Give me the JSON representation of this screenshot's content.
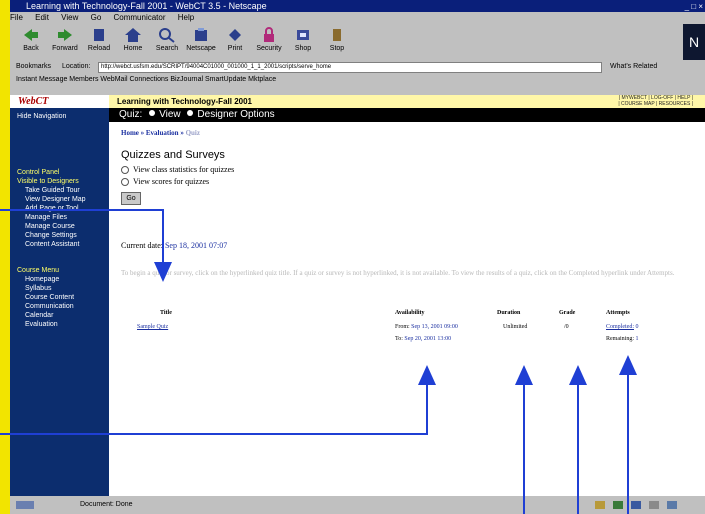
{
  "window": {
    "title": "Learning with Technology-Fall 2001 - WebCT 3.5 - Netscape",
    "controls": "_ □ ×"
  },
  "menu": [
    "File",
    "Edit",
    "View",
    "Go",
    "Communicator",
    "Help"
  ],
  "toolbar": {
    "buttons": [
      {
        "label": "Back",
        "icon": "back-arrow-icon"
      },
      {
        "label": "Forward",
        "icon": "forward-arrow-icon"
      },
      {
        "label": "Reload",
        "icon": "reload-icon"
      },
      {
        "label": "Home",
        "icon": "home-icon"
      },
      {
        "label": "Search",
        "icon": "search-icon"
      },
      {
        "label": "Netscape",
        "icon": "netscape-icon"
      },
      {
        "label": "Print",
        "icon": "print-icon"
      },
      {
        "label": "Security",
        "icon": "lock-icon"
      },
      {
        "label": "Shop",
        "icon": "shop-icon"
      },
      {
        "label": "Stop",
        "icon": "stop-icon"
      }
    ],
    "logo": "N"
  },
  "location": {
    "bookmarks_label": "Bookmarks",
    "location_label": "Location:",
    "url": "http://webct.usfsm.edu/SCRIPT/94004C01000_001000_1_1_2001/scripts/serve_home",
    "whats_related": "What's Related"
  },
  "personal_toolbar": "Instant Message   Members   WebMail   Connections   BizJournal   SmartUpdate   Mktplace",
  "webct": {
    "logo": "WebCT",
    "course_title": "Learning with Technology-Fall 2001",
    "top_links": "| MYWEBCT | LOG-OFF | HELP |\n| COURSE MAP | RESOURCES |"
  },
  "quizbar": {
    "quiz": "Quiz:",
    "view": "View",
    "designer": "Designer Options"
  },
  "sidebar": {
    "hide_nav": "Hide Navigation",
    "control_panel": "Control Panel",
    "visible_designers": "Visible to Designers",
    "designer_items": [
      "Take Guided Tour",
      "View Designer Map",
      "Add Page or Tool",
      "Manage Files",
      "Manage Course",
      "Change Settings",
      "Content Assistant"
    ],
    "course_menu": "Course Menu",
    "course_items": [
      "Homepage",
      "Syllabus",
      "Course Content",
      "Communication",
      "Calendar",
      "Evaluation"
    ]
  },
  "breadcrumb": {
    "home": "Home",
    "sep1": "»",
    "evaluation": "Evaluation",
    "sep2": "»",
    "quiz": "Quiz"
  },
  "quizzes": {
    "heading": "Quizzes and Surveys",
    "option1": "View class statistics for quizzes",
    "option2": "View scores for quizzes",
    "go": "Go"
  },
  "current_date": {
    "label": "Current date:",
    "value": "Sep 18, 2001 07:07"
  },
  "instructions": "To begin a quiz or survey, click on the hyperlinked quiz title. If a quiz or survey is not hyperlinked, it is not available. To view the results of a quiz, click on the Completed hyperlink under Attempts.",
  "table": {
    "headers": {
      "title": "Title",
      "availability": "Availability",
      "duration": "Duration",
      "grade": "Grade",
      "attempts": "Attempts"
    },
    "row": {
      "title": "Sample Quiz",
      "from_label": "From:",
      "from_value": "Sep 13, 2001 09:00",
      "to_label": "To:",
      "to_value": "Sep 20, 2001 13:00",
      "duration": "Unlimited",
      "grade": "/0",
      "completed_label": "Completed:",
      "completed_value": "0",
      "remaining_label": "Remaining:",
      "remaining_value": "1"
    }
  },
  "status": {
    "text": "Document: Done"
  },
  "colors": {
    "callout": "#1f3fd4",
    "sidebar": "#0c2d6e",
    "link": "#1a2fa0"
  }
}
